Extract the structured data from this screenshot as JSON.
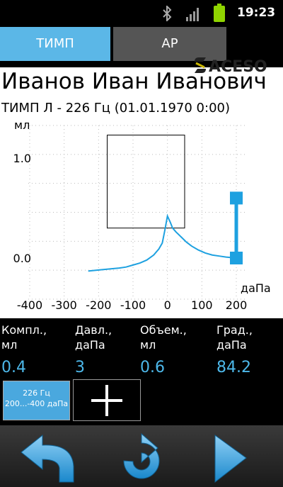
{
  "status_bar": {
    "time": "19:23",
    "icons": [
      "bluetooth-icon",
      "signal-icon",
      "battery-icon"
    ],
    "battery_color": "#8fd400"
  },
  "tabs": [
    {
      "label": "ТИМП",
      "active": true
    },
    {
      "label": "АР",
      "active": false
    }
  ],
  "patient": {
    "name": "Иванов Иван Иванович"
  },
  "exam": {
    "label": "ТИМП Л - 226 Гц (01.01.1970 0:00)"
  },
  "logo": {
    "text": "ACESO"
  },
  "chart_data": {
    "type": "line",
    "ylabel": "мл",
    "xlabel": "даПа",
    "x_ticks": [
      "-400",
      "-300",
      "-200",
      "-100",
      "0",
      "100",
      "200"
    ],
    "y_ticks": [
      "1.0",
      "0.0"
    ],
    "xlim": [
      -400,
      200
    ],
    "ylim": [
      0,
      1.0
    ],
    "grid": true,
    "series": [
      {
        "color": "#1ea1e0",
        "x": [
          -230,
          -200,
          -170,
          -140,
          -120,
          -100,
          -80,
          -60,
          -40,
          -25,
          -15,
          -8,
          0,
          8,
          15,
          25,
          40,
          55,
          70,
          90,
          110,
          130,
          150,
          170,
          200
        ],
        "y": [
          -0.13,
          -0.12,
          -0.11,
          -0.1,
          -0.09,
          -0.07,
          -0.05,
          -0.02,
          0.03,
          0.09,
          0.15,
          0.27,
          0.42,
          0.36,
          0.3,
          0.26,
          0.21,
          0.16,
          0.12,
          0.08,
          0.05,
          0.03,
          0.02,
          0.01,
          0.0
        ]
      }
    ],
    "compliance_box": {
      "x": [
        -175,
        50
      ],
      "y": [
        0.3,
        1.23
      ]
    },
    "pressure_bar": {
      "x": 200,
      "y": [
        0.0,
        0.6
      ]
    },
    "marker_color": "#1ea1e0"
  },
  "params": [
    {
      "label": "Компл.,\nмл",
      "value": "0.4"
    },
    {
      "label": "Давл.,\nдаПа",
      "value": "3"
    },
    {
      "label": "Объем.,\nмл",
      "value": "0.6"
    },
    {
      "label": "Град.,\nдаПа",
      "value": "84.2"
    }
  ],
  "protocol_button": {
    "line1": "226 Гц",
    "line2": "200...-400 даПа"
  },
  "nav": [
    "back-icon",
    "refresh-icon",
    "next-icon"
  ]
}
